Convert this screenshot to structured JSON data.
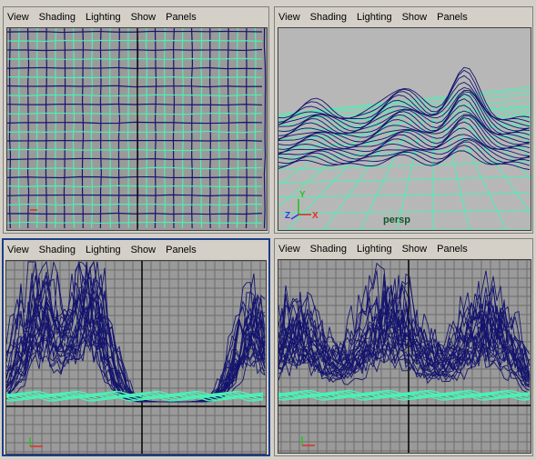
{
  "menu": [
    "View",
    "Shading",
    "Lighting",
    "Show",
    "Panels"
  ],
  "panels": [
    {
      "id": "top-left",
      "camera": ""
    },
    {
      "id": "top-right",
      "camera": "persp"
    },
    {
      "id": "bottom-left",
      "camera": ""
    },
    {
      "id": "bottom-right",
      "camera": ""
    }
  ],
  "axis_labels": {
    "y": "Y",
    "z": "Z",
    "x": "X"
  },
  "colors": {
    "wire": "#14146e",
    "mesh": "#4cf0b4",
    "grid": "#6c6c6c",
    "grid_bg": "#9a9a9a",
    "active_border": "#1c3e8a"
  }
}
